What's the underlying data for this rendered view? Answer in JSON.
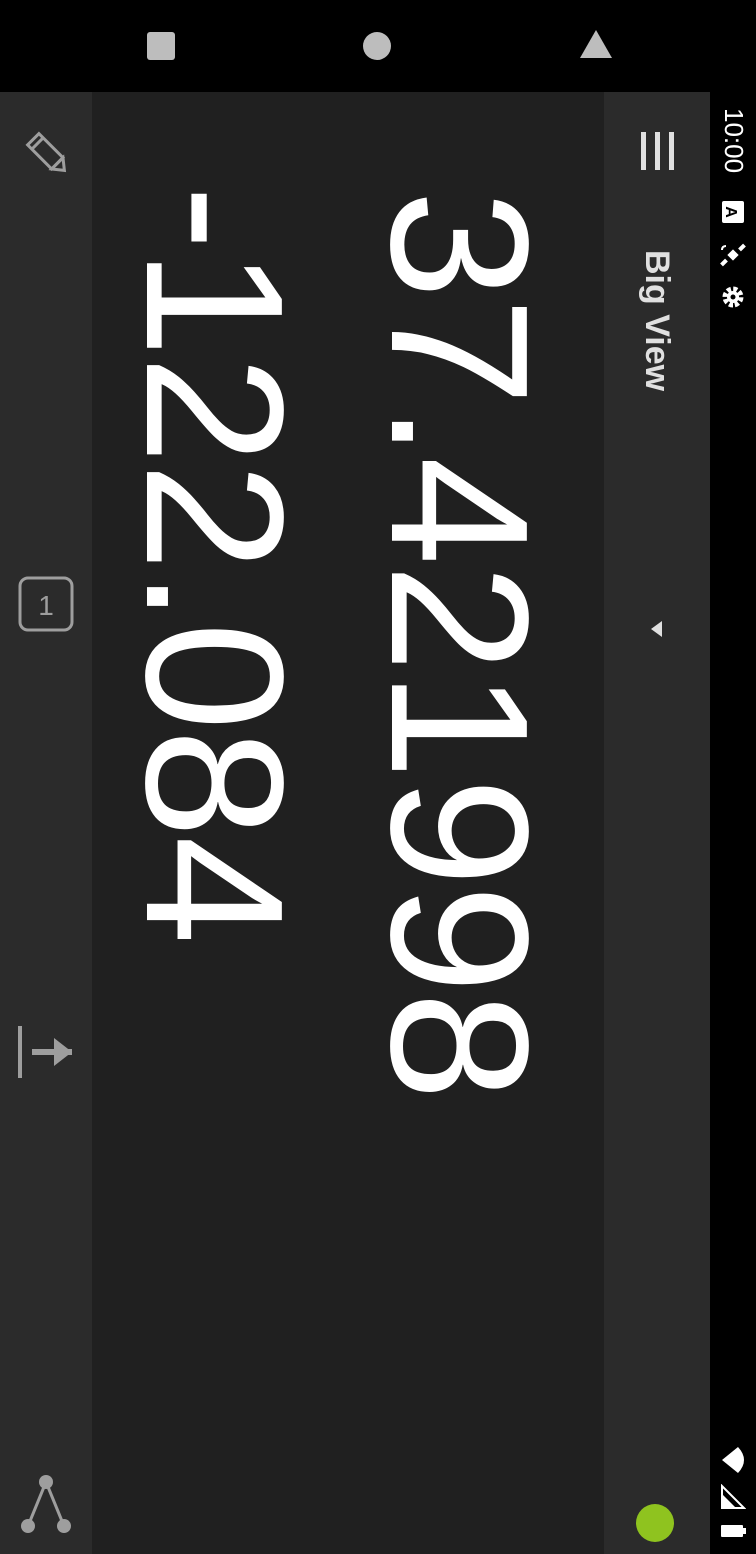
{
  "status_bar": {
    "time": "10:00",
    "icons": [
      "notification-a-icon",
      "satellite-icon",
      "settings-gear-icon"
    ],
    "system_icons": [
      "wifi-icon",
      "signal-icon",
      "battery-icon"
    ]
  },
  "toolbar": {
    "title": "Big View",
    "menu_icon": "hamburger-menu-icon",
    "dropdown_icon": "dropdown-arrow-icon",
    "status_indicator_color": "#8fc31f"
  },
  "coordinates": {
    "latitude": "37.421998",
    "longitude": "-122.084"
  },
  "bottom_bar": {
    "items": [
      {
        "icon": "pencil-icon"
      },
      {
        "icon": "page-one-icon",
        "label": "1"
      },
      {
        "icon": "go-to-arrow-icon"
      },
      {
        "icon": "share-icon"
      }
    ]
  },
  "nav_bar": {
    "buttons": [
      "back-icon",
      "home-icon",
      "recents-icon"
    ]
  },
  "colors": {
    "background": "#202020",
    "bar": "#2b2b2b",
    "text": "#ffffff",
    "accent": "#8fc31f"
  }
}
